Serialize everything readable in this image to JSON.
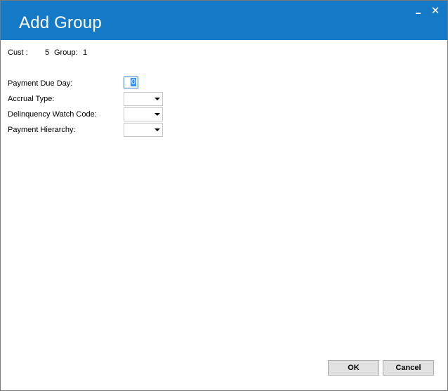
{
  "window": {
    "title": "Add Group",
    "minimize_icon": "minimize-icon",
    "close_icon": "close-icon",
    "close_glyph": "✕",
    "accent_color": "#1479c6"
  },
  "info": {
    "cust_label": "Cust :",
    "cust_value": "5",
    "group_label": "Group:",
    "group_value": "1"
  },
  "form": {
    "payment_due_day_label": "Payment Due Day:",
    "payment_due_day_value": "0",
    "accrual_type_label": "Accrual Type:",
    "accrual_type_value": "",
    "delinquency_watch_code_label": "Delinquency Watch Code:",
    "delinquency_watch_code_value": "",
    "payment_hierarchy_label": "Payment Hierarchy:",
    "payment_hierarchy_value": ""
  },
  "buttons": {
    "ok_label": "OK",
    "cancel_label": "Cancel"
  }
}
